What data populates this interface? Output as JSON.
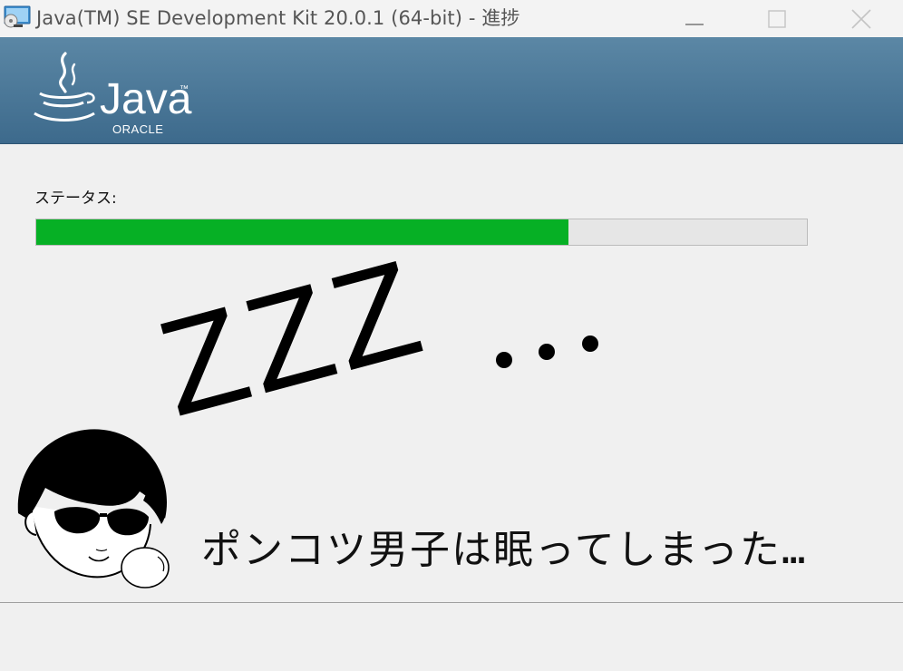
{
  "window": {
    "title": "Java(TM) SE Development Kit 20.0.1 (64-bit) - 進捗"
  },
  "banner": {
    "logo_word": "Java",
    "logo_tm": "™",
    "logo_sub": "ORACLE"
  },
  "status": {
    "label": "ステータス:",
    "progress": 0.69
  },
  "art": {
    "zzz": "ZZZ",
    "caption": "ポンコツ男子は眠ってしまった…"
  },
  "colors": {
    "progress_fill": "#06b025",
    "banner": "#4a7697"
  }
}
